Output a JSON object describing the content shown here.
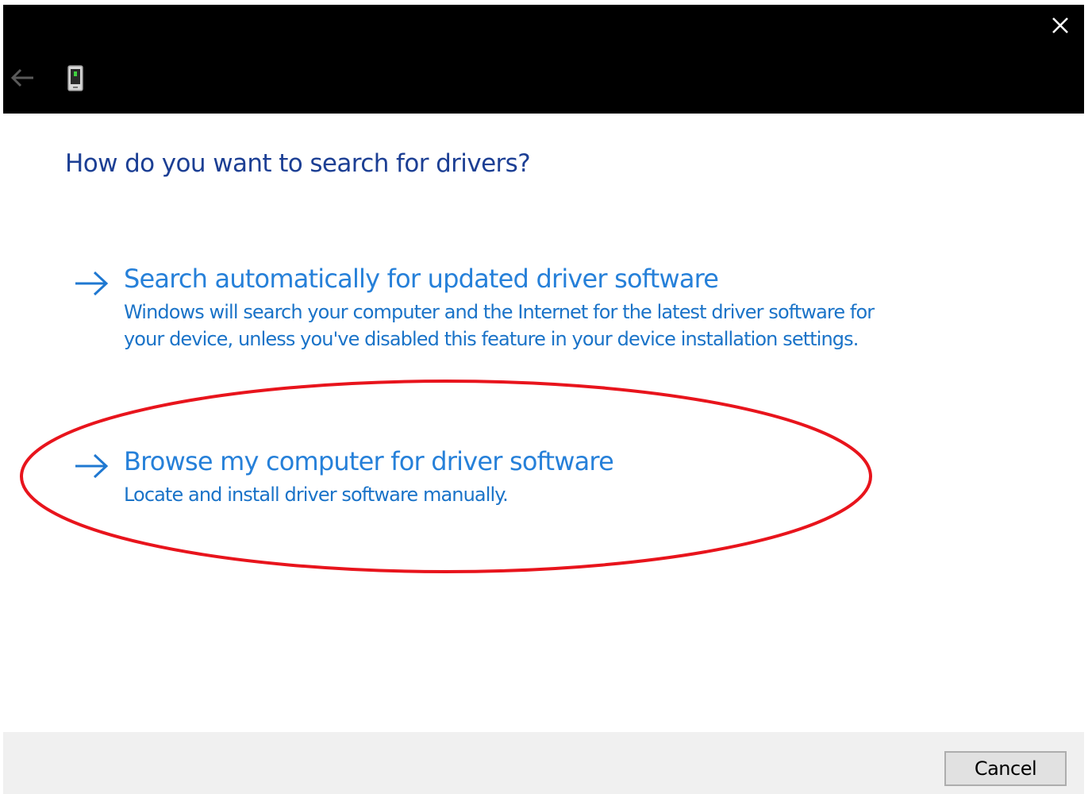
{
  "window": {
    "close_icon": "close-icon",
    "back_icon": "back-arrow-icon",
    "device_icon": "device-icon"
  },
  "heading": "How do you want to search for drivers?",
  "options": [
    {
      "title": "Search automatically for updated driver software",
      "description": "Windows will search your computer and the Internet for the latest driver software for your device, unless you've disabled this feature in your device installation settings.",
      "icon": "arrow-right-icon"
    },
    {
      "title": "Browse my computer for driver software",
      "description": "Locate and install driver software manually.",
      "icon": "arrow-right-icon",
      "highlighted": true
    }
  ],
  "footer": {
    "cancel_label": "Cancel"
  },
  "colors": {
    "titlebar": "#000000",
    "heading": "#1c3f94",
    "link": "#2680d9",
    "annotation": "#e8141c",
    "footer": "#f0f0f0"
  }
}
